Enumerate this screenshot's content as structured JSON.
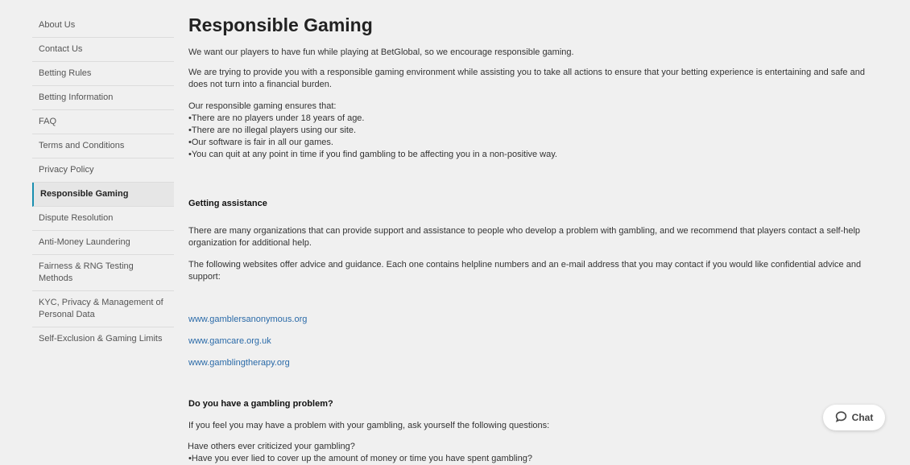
{
  "sidebar": {
    "items": [
      {
        "label": "About Us"
      },
      {
        "label": "Contact Us"
      },
      {
        "label": "Betting Rules"
      },
      {
        "label": "Betting Information"
      },
      {
        "label": "FAQ"
      },
      {
        "label": "Terms and Conditions"
      },
      {
        "label": "Privacy Policy"
      },
      {
        "label": "Responsible Gaming",
        "active": true
      },
      {
        "label": "Dispute Resolution"
      },
      {
        "label": "Anti-Money Laundering"
      },
      {
        "label": "Fairness & RNG Testing Methods"
      },
      {
        "label": "KYC, Privacy & Management of Personal Data"
      },
      {
        "label": "Self-Exclusion & Gaming Limits"
      }
    ]
  },
  "main": {
    "title": "Responsible Gaming",
    "intro1": "We want our players to have fun while playing at BetGlobal, so we encourage responsible gaming.",
    "intro2": "We are trying to provide you with a responsible gaming environment while assisting you to take all actions to ensure that your betting experience is entertaining and safe and does not turn into a financial burden.",
    "ensures_heading": "Our responsible gaming ensures that:",
    "ensures": [
      "•There are no players under 18 years of age.",
      "•There are no illegal players using our site.",
      "•Our software is fair in all our games.",
      "•You can quit at any point in time if you find gambling to be affecting you in a non-positive way."
    ],
    "assist_heading": "Getting assistance",
    "assist_p1": "There are many organizations that can provide support and assistance to people who develop a problem with gambling, and we recommend that players contact a self-help organization for additional help.",
    "assist_p2": "The following websites offer advice and guidance. Each one contains helpline numbers and an e-mail address that you may contact if you would like confidential advice and support:",
    "links": [
      "www.gamblersanonymous.org",
      "www.gamcare.org.uk",
      "www.gamblingtherapy.org"
    ],
    "problem_heading": "Do you have a gambling problem?",
    "problem_p": "If you feel you may have a problem with your gambling, ask yourself the following questions:",
    "questions": [
      "Have others ever criticized your gambling?",
      "•Have you ever lied to cover up the amount of money or time you have spent gambling?"
    ]
  },
  "chat": {
    "label": "Chat",
    "icon": "chat-bubble-icon"
  }
}
